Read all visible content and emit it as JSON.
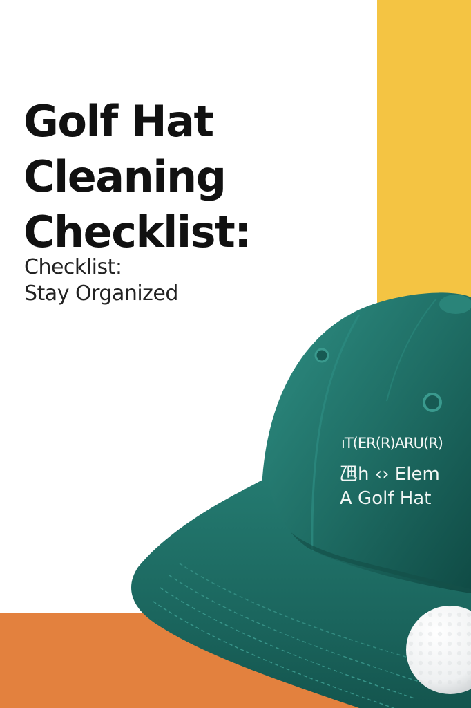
{
  "colors": {
    "background": "#ffffff",
    "accent_yellow": "#f4c443",
    "accent_orange": "#e3813e",
    "cap_green": "#1f6e65",
    "title_text": "#111111"
  },
  "title_lines": [
    "Golf Hat",
    "Cleaning",
    "Checklist:"
  ],
  "subtitle_lines": [
    "Checklist:",
    "Stay Organized"
  ],
  "cap": {
    "embroidery_top": "ıT(ER(R)ARU(R)",
    "embroidery_middle": "乪h ‹› Elem",
    "embroidery_bottom": "A Golf Hat"
  }
}
